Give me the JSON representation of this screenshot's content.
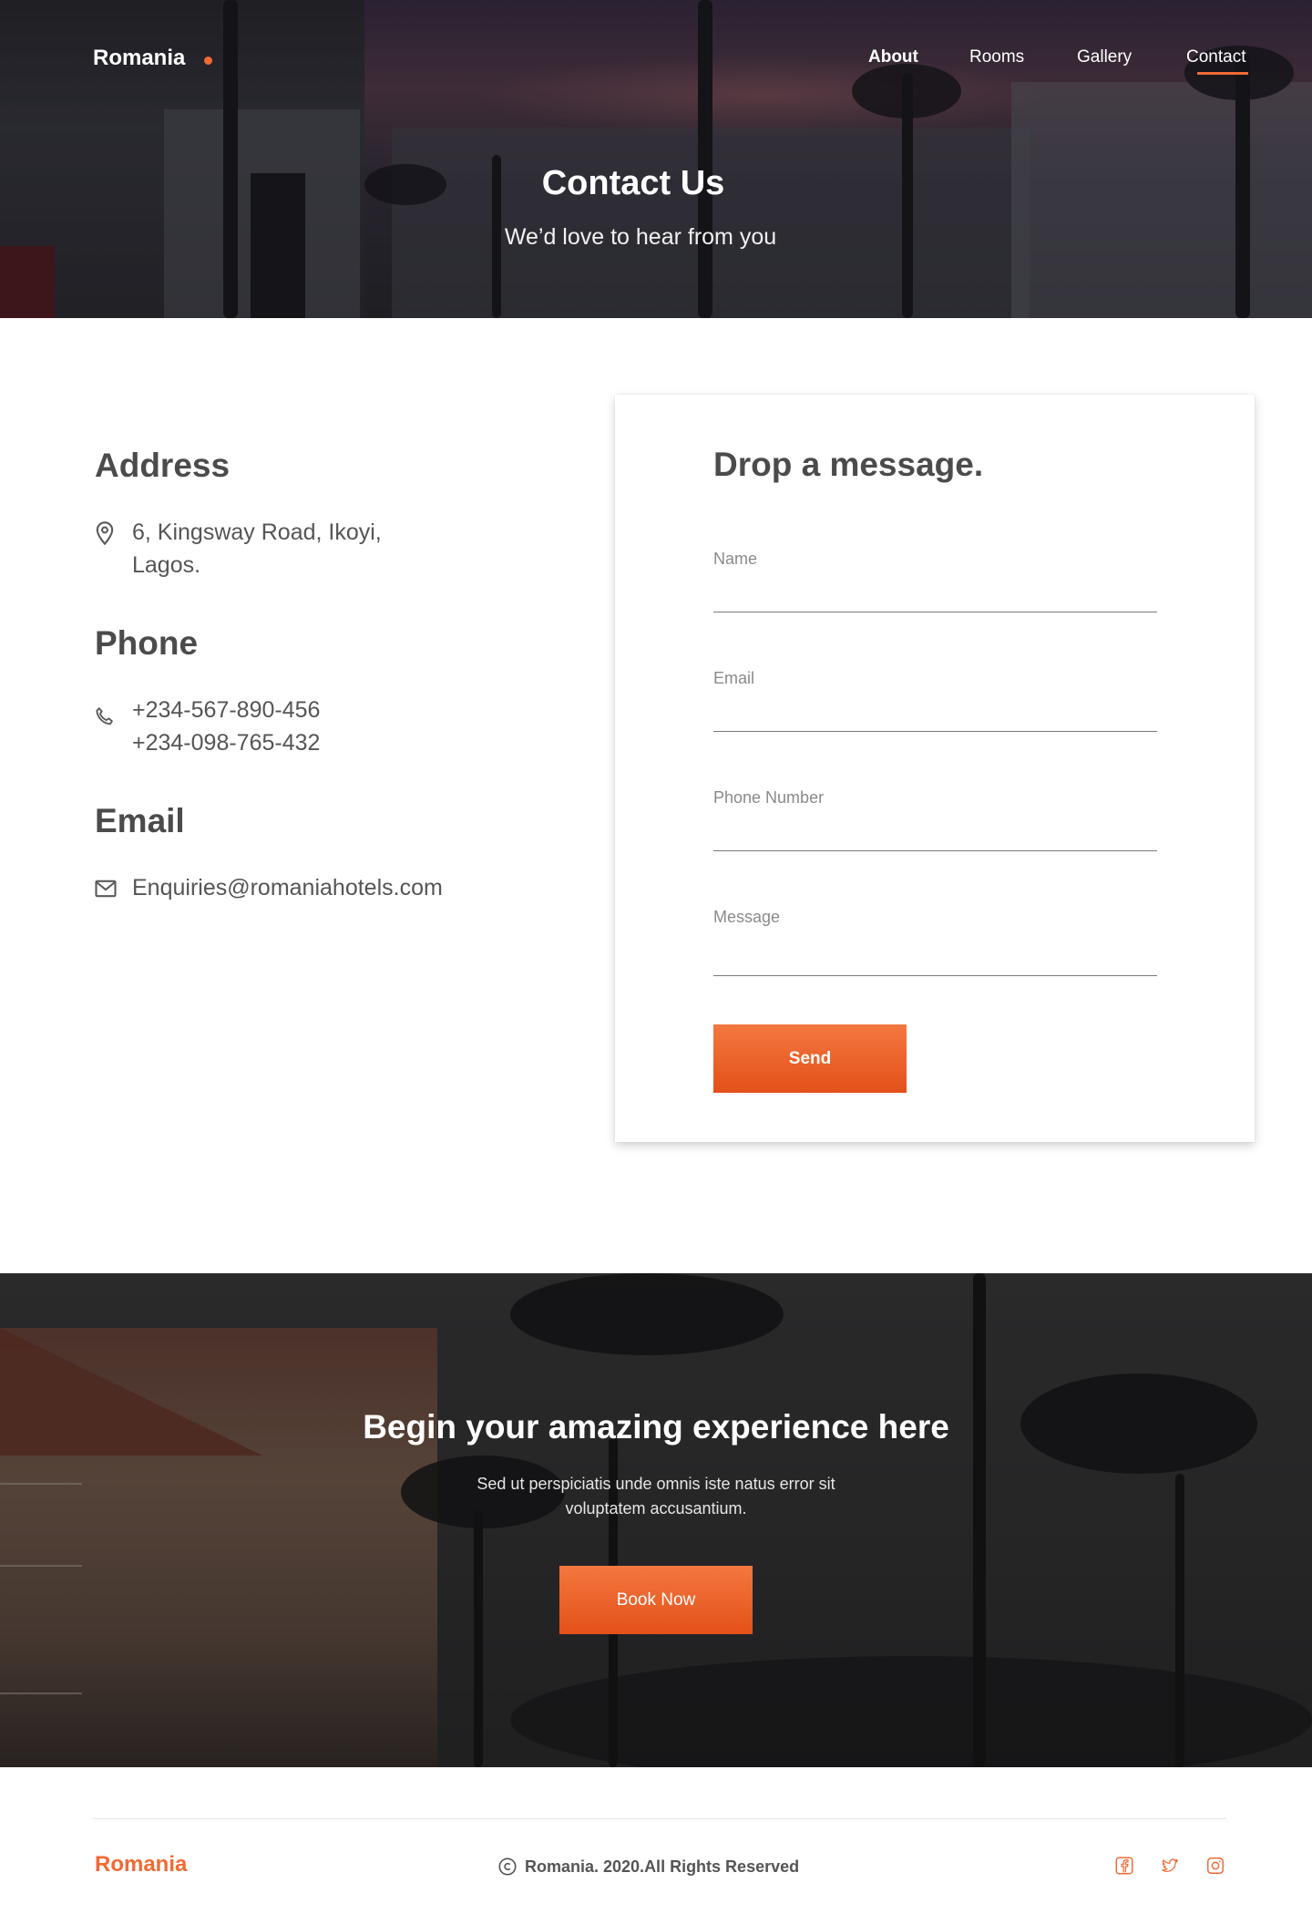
{
  "brand": {
    "name": "Romania"
  },
  "nav": {
    "items": [
      {
        "label": "About"
      },
      {
        "label": "Rooms"
      },
      {
        "label": "Gallery"
      },
      {
        "label": "Contact"
      }
    ]
  },
  "hero": {
    "title": "Contact Us",
    "subtitle": "We’d love to hear from you"
  },
  "contact_info": {
    "address_heading": "Address",
    "address_line1": "6, Kingsway Road, Ikoyi,",
    "address_line2": "Lagos.",
    "phone_heading": "Phone",
    "phone1": "+234-567-890-456",
    "phone2": "+234-098-765-432",
    "email_heading": "Email",
    "email": "Enquiries@romaniahotels.com"
  },
  "form": {
    "title": "Drop a message.",
    "fields": {
      "name_label": "Name",
      "email_label": "Email",
      "phone_label": "Phone Number",
      "message_label": "Message"
    },
    "send_label": "Send"
  },
  "cta": {
    "title": "Begin your amazing experience here",
    "text_line1": "Sed ut perspiciatis unde omnis iste natus error sit",
    "text_line2": "voluptatem accusantium.",
    "button_label": "Book Now"
  },
  "footer": {
    "brand": "Romania",
    "copyright": "Romania. 2020.All Rights Reserved",
    "social_icons": [
      "facebook-icon",
      "twitter-icon",
      "instagram-icon"
    ]
  },
  "colors": {
    "accent": "#f06a35",
    "text_dark": "#4b4b4b"
  }
}
